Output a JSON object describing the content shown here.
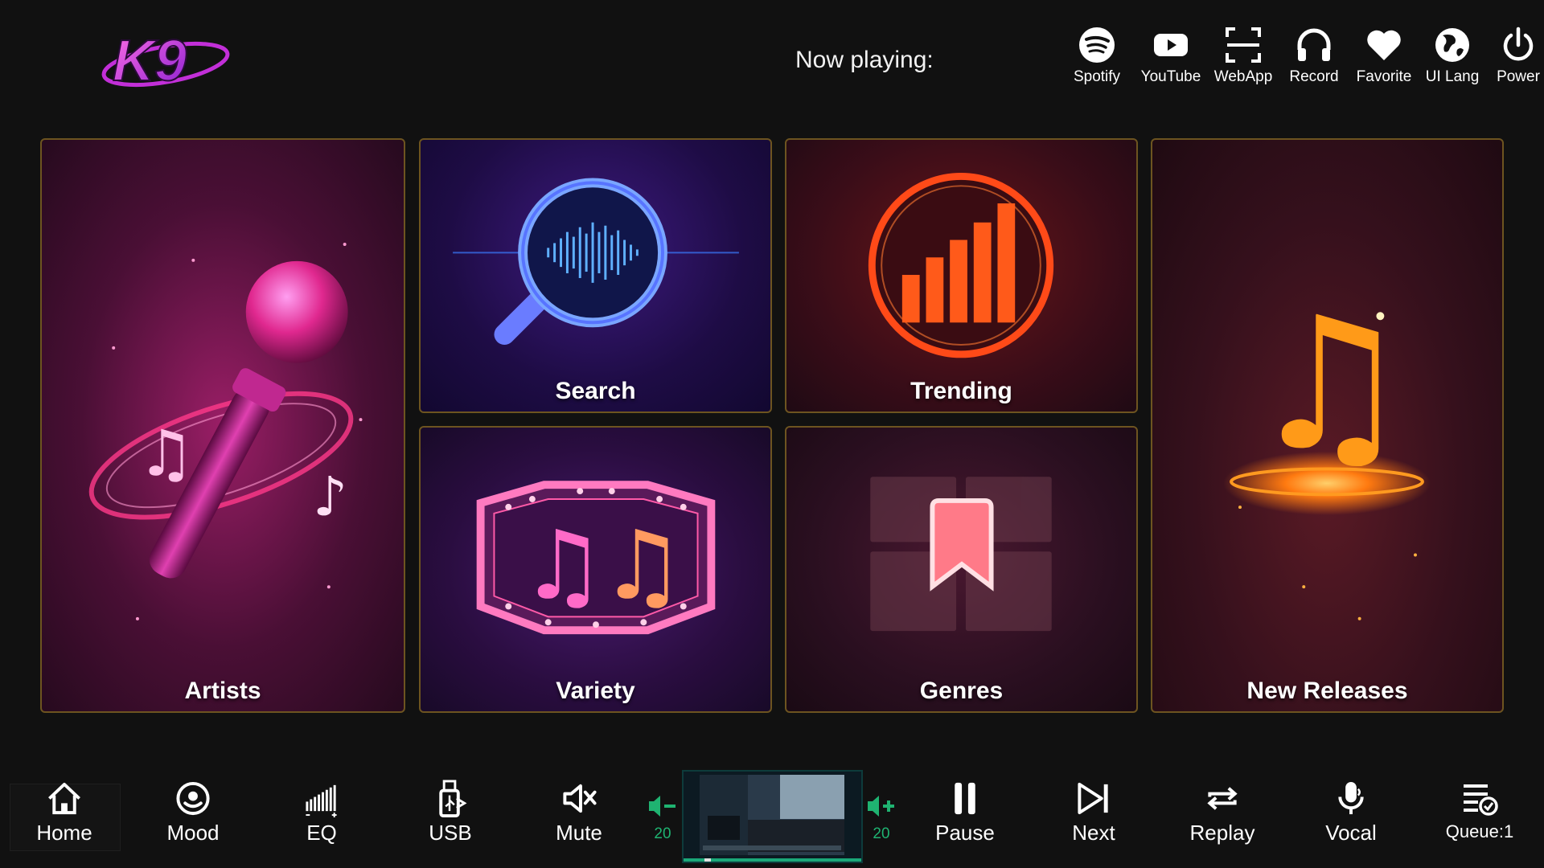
{
  "header": {
    "logo_text": "K9",
    "now_playing_label": "Now playing:",
    "actions": [
      {
        "label": "Spotify",
        "icon": "spotify-icon"
      },
      {
        "label": "YouTube",
        "icon": "youtube-icon"
      },
      {
        "label": "WebApp",
        "icon": "scan-frame-icon"
      },
      {
        "label": "Record",
        "icon": "headphones-icon"
      },
      {
        "label": "Favorite",
        "icon": "heart-icon"
      },
      {
        "label": "UI Lang",
        "icon": "globe-icon"
      },
      {
        "label": "Power",
        "icon": "power-icon"
      }
    ]
  },
  "tiles": {
    "artists": "Artists",
    "search": "Search",
    "trending": "Trending",
    "variety": "Variety",
    "genres": "Genres",
    "new_releases": "New Releases"
  },
  "bottom_bar": {
    "home": "Home",
    "mood": "Mood",
    "eq": "EQ",
    "usb": "USB",
    "mute": "Mute",
    "volume_down": "20",
    "volume_up": "20",
    "pause": "Pause",
    "next": "Next",
    "replay": "Replay",
    "vocal": "Vocal",
    "queue": "Queue:1"
  },
  "colors": {
    "background": "#111111",
    "tile_border": "#6d5420",
    "volume_green": "#1fb371",
    "logo_magenta": "#d23ad8"
  }
}
